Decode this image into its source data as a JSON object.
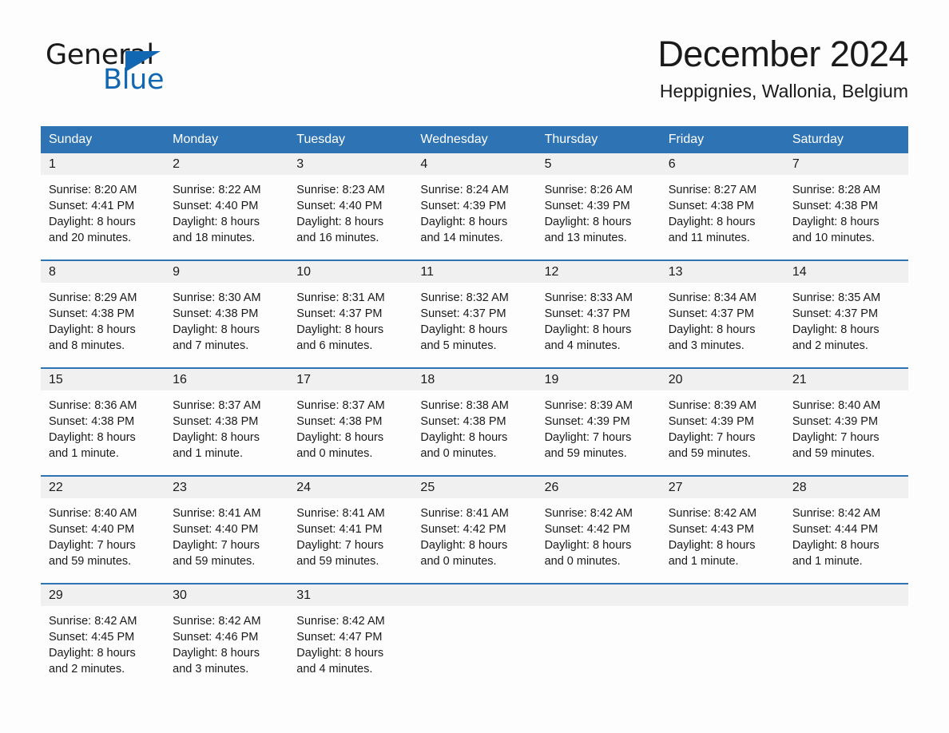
{
  "brand": {
    "name_part1": "General",
    "name_part2": "Blue",
    "logo_icon": "triangle-icon",
    "accent_color": "#1167b1"
  },
  "header": {
    "title": "December 2024",
    "location": "Heppignies, Wallonia, Belgium"
  },
  "colors": {
    "header_blue": "#2e74b5",
    "daynum_band": "#f0f0f0",
    "page_background": "#fdfdfd",
    "text": "#1a1a1a"
  },
  "calendar": {
    "weekday_headers": [
      "Sunday",
      "Monday",
      "Tuesday",
      "Wednesday",
      "Thursday",
      "Friday",
      "Saturday"
    ],
    "weeks": [
      [
        {
          "day": "1",
          "sunrise": "Sunrise: 8:20 AM",
          "sunset": "Sunset: 4:41 PM",
          "daylight_line1": "Daylight: 8 hours",
          "daylight_line2": "and 20 minutes."
        },
        {
          "day": "2",
          "sunrise": "Sunrise: 8:22 AM",
          "sunset": "Sunset: 4:40 PM",
          "daylight_line1": "Daylight: 8 hours",
          "daylight_line2": "and 18 minutes."
        },
        {
          "day": "3",
          "sunrise": "Sunrise: 8:23 AM",
          "sunset": "Sunset: 4:40 PM",
          "daylight_line1": "Daylight: 8 hours",
          "daylight_line2": "and 16 minutes."
        },
        {
          "day": "4",
          "sunrise": "Sunrise: 8:24 AM",
          "sunset": "Sunset: 4:39 PM",
          "daylight_line1": "Daylight: 8 hours",
          "daylight_line2": "and 14 minutes."
        },
        {
          "day": "5",
          "sunrise": "Sunrise: 8:26 AM",
          "sunset": "Sunset: 4:39 PM",
          "daylight_line1": "Daylight: 8 hours",
          "daylight_line2": "and 13 minutes."
        },
        {
          "day": "6",
          "sunrise": "Sunrise: 8:27 AM",
          "sunset": "Sunset: 4:38 PM",
          "daylight_line1": "Daylight: 8 hours",
          "daylight_line2": "and 11 minutes."
        },
        {
          "day": "7",
          "sunrise": "Sunrise: 8:28 AM",
          "sunset": "Sunset: 4:38 PM",
          "daylight_line1": "Daylight: 8 hours",
          "daylight_line2": "and 10 minutes."
        }
      ],
      [
        {
          "day": "8",
          "sunrise": "Sunrise: 8:29 AM",
          "sunset": "Sunset: 4:38 PM",
          "daylight_line1": "Daylight: 8 hours",
          "daylight_line2": "and 8 minutes."
        },
        {
          "day": "9",
          "sunrise": "Sunrise: 8:30 AM",
          "sunset": "Sunset: 4:38 PM",
          "daylight_line1": "Daylight: 8 hours",
          "daylight_line2": "and 7 minutes."
        },
        {
          "day": "10",
          "sunrise": "Sunrise: 8:31 AM",
          "sunset": "Sunset: 4:37 PM",
          "daylight_line1": "Daylight: 8 hours",
          "daylight_line2": "and 6 minutes."
        },
        {
          "day": "11",
          "sunrise": "Sunrise: 8:32 AM",
          "sunset": "Sunset: 4:37 PM",
          "daylight_line1": "Daylight: 8 hours",
          "daylight_line2": "and 5 minutes."
        },
        {
          "day": "12",
          "sunrise": "Sunrise: 8:33 AM",
          "sunset": "Sunset: 4:37 PM",
          "daylight_line1": "Daylight: 8 hours",
          "daylight_line2": "and 4 minutes."
        },
        {
          "day": "13",
          "sunrise": "Sunrise: 8:34 AM",
          "sunset": "Sunset: 4:37 PM",
          "daylight_line1": "Daylight: 8 hours",
          "daylight_line2": "and 3 minutes."
        },
        {
          "day": "14",
          "sunrise": "Sunrise: 8:35 AM",
          "sunset": "Sunset: 4:37 PM",
          "daylight_line1": "Daylight: 8 hours",
          "daylight_line2": "and 2 minutes."
        }
      ],
      [
        {
          "day": "15",
          "sunrise": "Sunrise: 8:36 AM",
          "sunset": "Sunset: 4:38 PM",
          "daylight_line1": "Daylight: 8 hours",
          "daylight_line2": "and 1 minute."
        },
        {
          "day": "16",
          "sunrise": "Sunrise: 8:37 AM",
          "sunset": "Sunset: 4:38 PM",
          "daylight_line1": "Daylight: 8 hours",
          "daylight_line2": "and 1 minute."
        },
        {
          "day": "17",
          "sunrise": "Sunrise: 8:37 AM",
          "sunset": "Sunset: 4:38 PM",
          "daylight_line1": "Daylight: 8 hours",
          "daylight_line2": "and 0 minutes."
        },
        {
          "day": "18",
          "sunrise": "Sunrise: 8:38 AM",
          "sunset": "Sunset: 4:38 PM",
          "daylight_line1": "Daylight: 8 hours",
          "daylight_line2": "and 0 minutes."
        },
        {
          "day": "19",
          "sunrise": "Sunrise: 8:39 AM",
          "sunset": "Sunset: 4:39 PM",
          "daylight_line1": "Daylight: 7 hours",
          "daylight_line2": "and 59 minutes."
        },
        {
          "day": "20",
          "sunrise": "Sunrise: 8:39 AM",
          "sunset": "Sunset: 4:39 PM",
          "daylight_line1": "Daylight: 7 hours",
          "daylight_line2": "and 59 minutes."
        },
        {
          "day": "21",
          "sunrise": "Sunrise: 8:40 AM",
          "sunset": "Sunset: 4:39 PM",
          "daylight_line1": "Daylight: 7 hours",
          "daylight_line2": "and 59 minutes."
        }
      ],
      [
        {
          "day": "22",
          "sunrise": "Sunrise: 8:40 AM",
          "sunset": "Sunset: 4:40 PM",
          "daylight_line1": "Daylight: 7 hours",
          "daylight_line2": "and 59 minutes."
        },
        {
          "day": "23",
          "sunrise": "Sunrise: 8:41 AM",
          "sunset": "Sunset: 4:40 PM",
          "daylight_line1": "Daylight: 7 hours",
          "daylight_line2": "and 59 minutes."
        },
        {
          "day": "24",
          "sunrise": "Sunrise: 8:41 AM",
          "sunset": "Sunset: 4:41 PM",
          "daylight_line1": "Daylight: 7 hours",
          "daylight_line2": "and 59 minutes."
        },
        {
          "day": "25",
          "sunrise": "Sunrise: 8:41 AM",
          "sunset": "Sunset: 4:42 PM",
          "daylight_line1": "Daylight: 8 hours",
          "daylight_line2": "and 0 minutes."
        },
        {
          "day": "26",
          "sunrise": "Sunrise: 8:42 AM",
          "sunset": "Sunset: 4:42 PM",
          "daylight_line1": "Daylight: 8 hours",
          "daylight_line2": "and 0 minutes."
        },
        {
          "day": "27",
          "sunrise": "Sunrise: 8:42 AM",
          "sunset": "Sunset: 4:43 PM",
          "daylight_line1": "Daylight: 8 hours",
          "daylight_line2": "and 1 minute."
        },
        {
          "day": "28",
          "sunrise": "Sunrise: 8:42 AM",
          "sunset": "Sunset: 4:44 PM",
          "daylight_line1": "Daylight: 8 hours",
          "daylight_line2": "and 1 minute."
        }
      ],
      [
        {
          "day": "29",
          "sunrise": "Sunrise: 8:42 AM",
          "sunset": "Sunset: 4:45 PM",
          "daylight_line1": "Daylight: 8 hours",
          "daylight_line2": "and 2 minutes."
        },
        {
          "day": "30",
          "sunrise": "Sunrise: 8:42 AM",
          "sunset": "Sunset: 4:46 PM",
          "daylight_line1": "Daylight: 8 hours",
          "daylight_line2": "and 3 minutes."
        },
        {
          "day": "31",
          "sunrise": "Sunrise: 8:42 AM",
          "sunset": "Sunset: 4:47 PM",
          "daylight_line1": "Daylight: 8 hours",
          "daylight_line2": "and 4 minutes."
        },
        {
          "day": "",
          "sunrise": "",
          "sunset": "",
          "daylight_line1": "",
          "daylight_line2": ""
        },
        {
          "day": "",
          "sunrise": "",
          "sunset": "",
          "daylight_line1": "",
          "daylight_line2": ""
        },
        {
          "day": "",
          "sunrise": "",
          "sunset": "",
          "daylight_line1": "",
          "daylight_line2": ""
        },
        {
          "day": "",
          "sunrise": "",
          "sunset": "",
          "daylight_line1": "",
          "daylight_line2": ""
        }
      ]
    ]
  }
}
